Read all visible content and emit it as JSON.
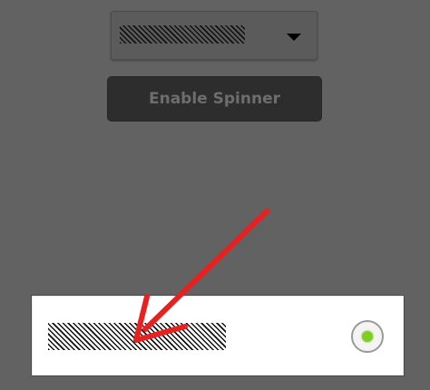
{
  "spinner": {
    "selected_value": "",
    "caret_icon": "triangle-down-icon"
  },
  "enable_button": {
    "label": "Enable Spinner"
  },
  "list_item": {
    "label": "",
    "radio_checked": true
  },
  "annotation": {
    "arrow_icon": "red-arrow-icon",
    "color": "#e82020"
  },
  "colors": {
    "background": "#626262",
    "button": "#2d2d2d",
    "radio_dot": "#7fcf22"
  }
}
